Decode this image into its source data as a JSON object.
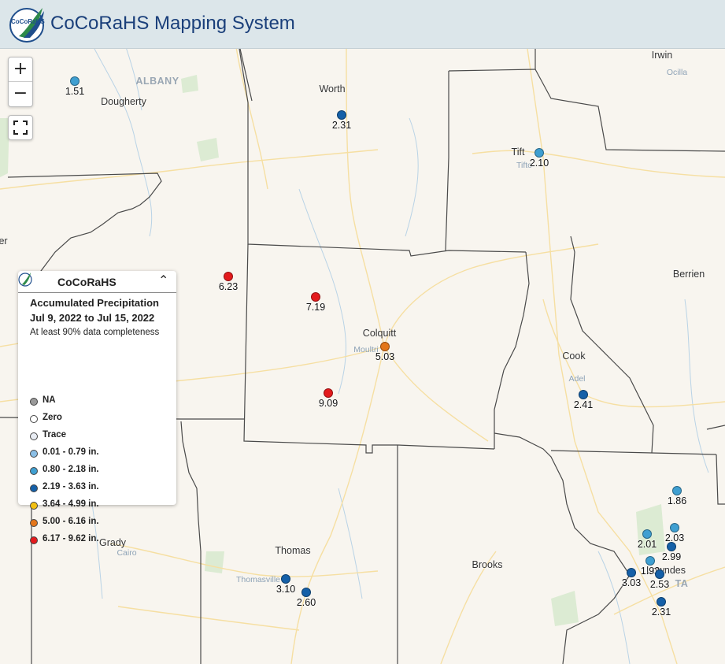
{
  "header": {
    "title": "CoCoRaHS Mapping System",
    "logo_text": "CoCoRaHS"
  },
  "map_controls": {
    "zoom_in": "+",
    "zoom_out": "−",
    "fullscreen_icon": "fullscreen-icon"
  },
  "legend": {
    "brand": "CoCoRaHS",
    "title": "Accumulated Precipitation",
    "date_range": "Jul 9, 2022 to Jul 15, 2022",
    "note": "At least 90% data completeness",
    "items": [
      {
        "label": "NA",
        "color": "#9a9a9a"
      },
      {
        "label": "Zero",
        "color": "#ffffff"
      },
      {
        "label": "Trace",
        "color": "#e8ecf3"
      },
      {
        "label": "0.01 - 0.79 in.",
        "color": "#8bbfe6"
      },
      {
        "label": "0.80 - 2.18 in.",
        "color": "#3f9fd1"
      },
      {
        "label": "2.19 - 3.63 in.",
        "color": "#1560a8"
      },
      {
        "label": "3.64 - 4.99 in.",
        "color": "#f2c012"
      },
      {
        "label": "5.00 - 6.16 in.",
        "color": "#e3761a"
      },
      {
        "label": "6.17 - 9.62 in.",
        "color": "#e31a1c"
      }
    ]
  },
  "county_labels": [
    "Worth",
    "Dougherty",
    "Tift",
    "Irwin",
    "Colquitt",
    "Berrien",
    "Cook",
    "Thomas",
    "Brooks",
    "Grady",
    "Lowndes"
  ],
  "city_labels": [
    "ALBANY"
  ],
  "town_labels": [
    "Ocilla",
    "Tifto",
    "Moultri",
    "Adel",
    "Cairo",
    "Thomasville"
  ],
  "edge_fragments": [
    "er",
    "TA"
  ],
  "observations": [
    {
      "value": "1.51",
      "category": 4
    },
    {
      "value": "2.31",
      "category": 5
    },
    {
      "value": "2.10",
      "category": 4
    },
    {
      "value": "6.23",
      "category": 8
    },
    {
      "value": "7.19",
      "category": 8
    },
    {
      "value": "5.03",
      "category": 7
    },
    {
      "value": "9.09",
      "category": 8
    },
    {
      "value": "2.41",
      "category": 5
    },
    {
      "value": "1.86",
      "category": 4
    },
    {
      "value": "2.03",
      "category": 4
    },
    {
      "value": "2.01",
      "category": 4
    },
    {
      "value": "2.99",
      "category": 5
    },
    {
      "value": "1.92",
      "category": 4
    },
    {
      "value": "3.03",
      "category": 5
    },
    {
      "value": "2.53",
      "category": 5
    },
    {
      "value": "2.31",
      "category": 5
    },
    {
      "value": "3.10",
      "category": 5
    },
    {
      "value": "2.60",
      "category": 5
    }
  ]
}
